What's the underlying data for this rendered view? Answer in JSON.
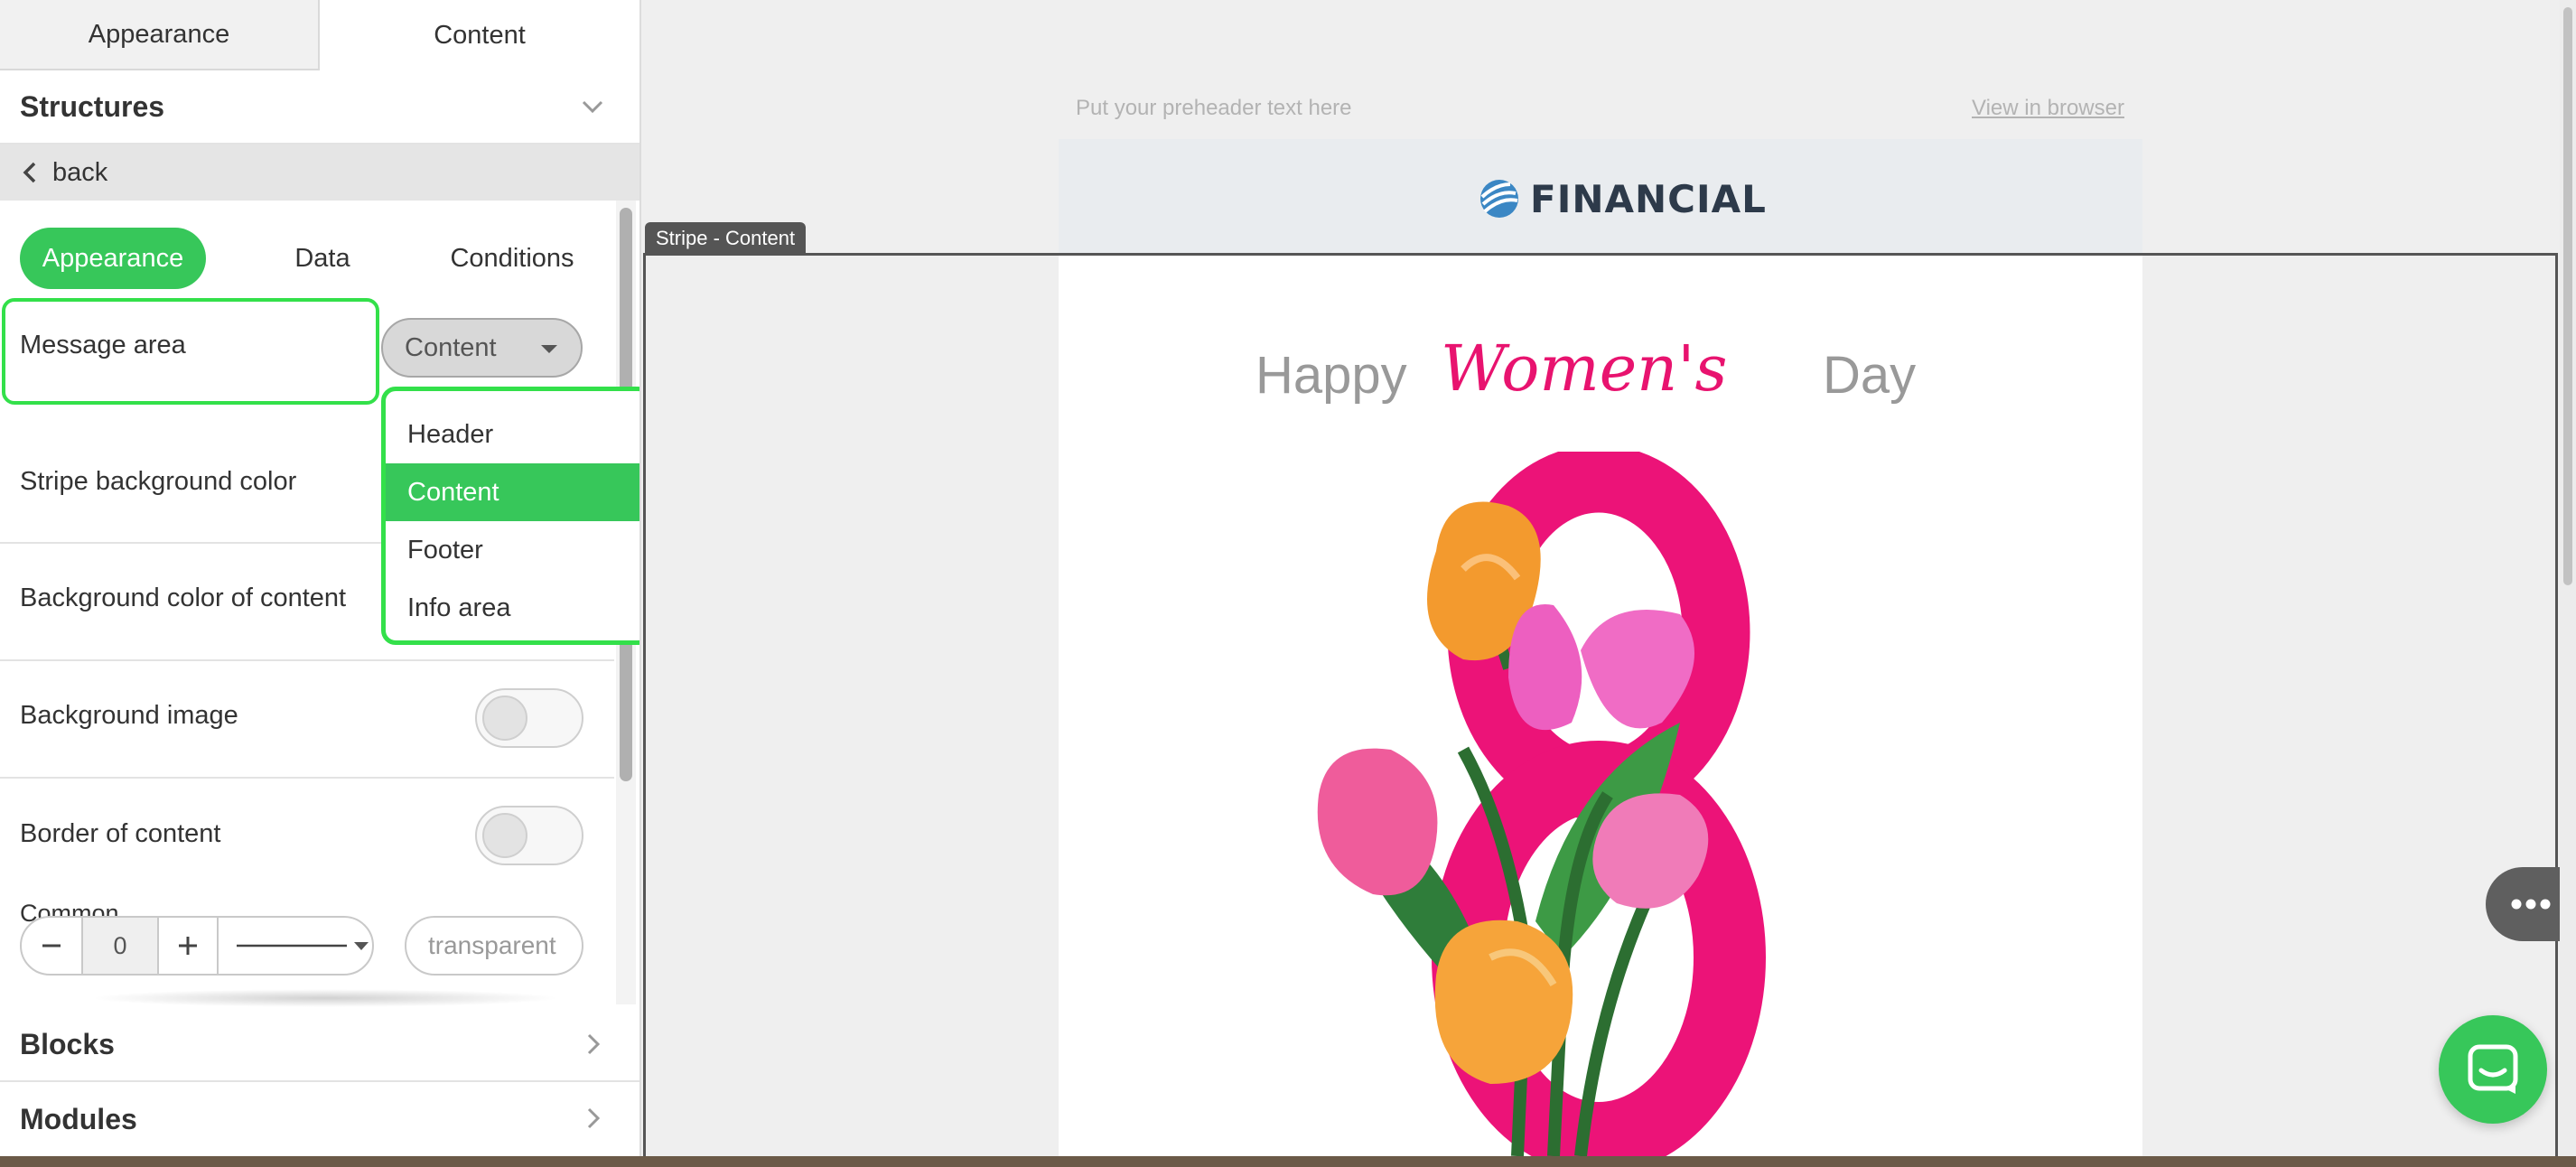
{
  "top_tabs": [
    {
      "label": "Appearance",
      "active": false
    },
    {
      "label": "Content",
      "active": true
    }
  ],
  "structures": {
    "title": "Structures"
  },
  "back": {
    "label": "back"
  },
  "settings_tabs": [
    {
      "label": "Appearance",
      "active": true
    },
    {
      "label": "Data",
      "active": false
    },
    {
      "label": "Conditions",
      "active": false
    }
  ],
  "message_area": {
    "label": "Message area",
    "selected": "Content"
  },
  "dropdown": {
    "options": [
      "Header",
      "Content",
      "Footer",
      "Info area"
    ],
    "selected_index": 1
  },
  "stripe_bg": {
    "label": "Stripe background color"
  },
  "content_bg": {
    "label": "Background color of content"
  },
  "bg_image": {
    "label": "Background image",
    "enabled": false
  },
  "border_content": {
    "label": "Border of content",
    "enabled": false
  },
  "common": {
    "label": "Common",
    "width_value": "0",
    "color_placeholder": "transparent"
  },
  "blocks": {
    "title": "Blocks"
  },
  "modules": {
    "title": "Modules"
  },
  "canvas": {
    "preheader": "Put your preheader text here",
    "view_in_browser": "View in browser",
    "logo_text": "FINANCIAL",
    "stripe_label": "Stripe - Content",
    "headline": {
      "word1": "Happy",
      "word2": "Women's",
      "word3": "Day"
    }
  },
  "colors": {
    "accent": "#37c75a",
    "highlight": "#33e04a",
    "pink": "#e8136f"
  }
}
